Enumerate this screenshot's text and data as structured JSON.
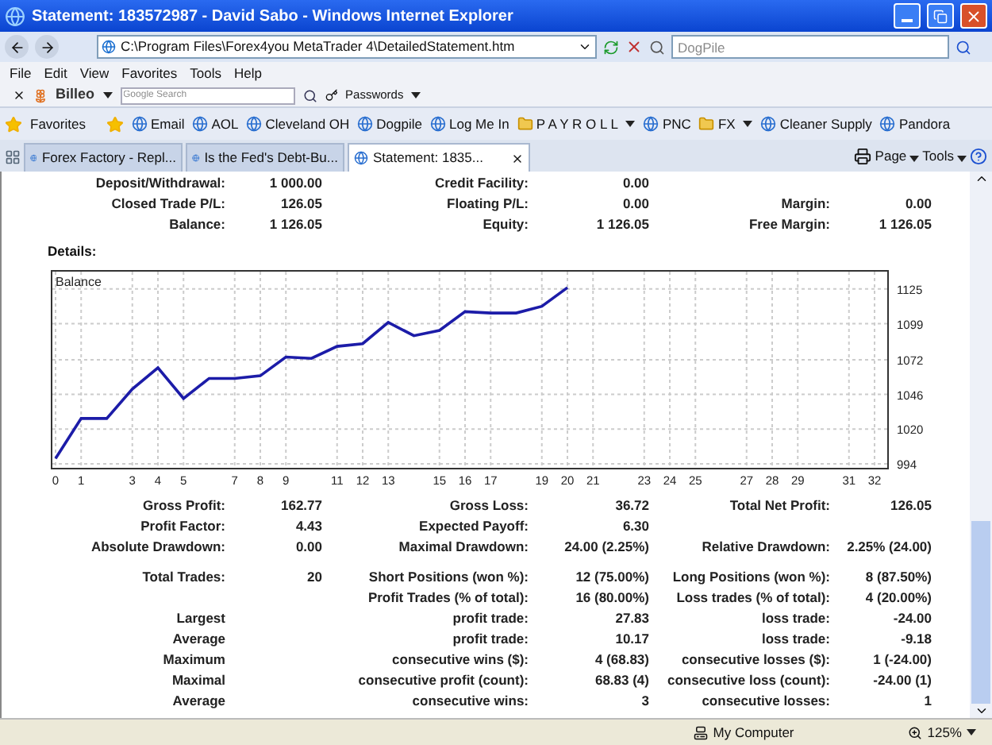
{
  "window": {
    "title": "Statement: 183572987 - David Sabo - Windows Internet Explorer"
  },
  "address_bar": {
    "url": "C:\\Program Files\\Forex4you MetaTrader 4\\DetailedStatement.htm"
  },
  "search": {
    "placeholder": "DogPile"
  },
  "menu": [
    "File",
    "Edit",
    "View",
    "Favorites",
    "Tools",
    "Help"
  ],
  "links_toolbar": {
    "brand": "Billeo",
    "search_placeholder": "Google Search",
    "passwords": "Passwords"
  },
  "favorites_bar": {
    "label": "Favorites",
    "items": [
      {
        "label": "Email",
        "kind": "link"
      },
      {
        "label": "AOL",
        "kind": "link"
      },
      {
        "label": "Cleveland OH",
        "kind": "link"
      },
      {
        "label": "Dogpile",
        "kind": "link"
      },
      {
        "label": "Log Me In",
        "kind": "link"
      },
      {
        "label": "P A Y R O L L",
        "kind": "folder"
      },
      {
        "label": "PNC",
        "kind": "link"
      },
      {
        "label": "FX",
        "kind": "folder"
      },
      {
        "label": "Cleaner Supply",
        "kind": "link"
      },
      {
        "label": "Pandora",
        "kind": "link"
      }
    ]
  },
  "tabs": [
    {
      "label": "Forex Factory - Repl...",
      "selected": false
    },
    {
      "label": "Is the Fed's Debt-Bu...",
      "selected": false
    },
    {
      "label": "Statement: 1835...",
      "selected": true
    }
  ],
  "command_bar": [
    "Page",
    "Tools"
  ],
  "summary": [
    {
      "c1": {
        "label": "Deposit/Withdrawal:",
        "value": "1 000.00"
      },
      "c2": {
        "label": "Credit Facility:",
        "value": "0.00"
      }
    },
    {
      "c1": {
        "label": "Closed Trade P/L:",
        "value": "126.05"
      },
      "c2": {
        "label": "Floating P/L:",
        "value": "0.00"
      },
      "c3": {
        "label": "Margin:",
        "value": "0.00"
      }
    },
    {
      "c1": {
        "label": "Balance:",
        "value": "1 126.05"
      },
      "c2": {
        "label": "Equity:",
        "value": "1 126.05"
      },
      "c3": {
        "label": "Free Margin:",
        "value": "1 126.05"
      }
    }
  ],
  "details_heading": "Details:",
  "chart_data": {
    "type": "line",
    "grid": true,
    "x": [
      0,
      1,
      2,
      3,
      4,
      5,
      6,
      7,
      8,
      9,
      10,
      11,
      12,
      13,
      14,
      15,
      16,
      17,
      18,
      19,
      20
    ],
    "series": [
      {
        "name": "Balance",
        "color": "#1c1ca8",
        "values": [
          998,
          1028,
          1028,
          1050,
          1066,
          1043,
          1058,
          1058,
          1060,
          1074,
          1073,
          1082,
          1084,
          1100,
          1090,
          1094,
          1108,
          1107,
          1107,
          1112,
          1126
        ]
      }
    ],
    "xlim": [
      0,
      32
    ],
    "ylim": [
      994,
      1138
    ],
    "xticks": [
      0,
      1,
      3,
      4,
      5,
      7,
      8,
      9,
      11,
      12,
      13,
      15,
      16,
      17,
      19,
      20,
      21,
      23,
      24,
      25,
      27,
      28,
      29,
      31,
      32
    ],
    "yticks": [
      994,
      1020,
      1046,
      1072,
      1099,
      1125
    ]
  },
  "stats": [
    [
      {
        "c1": {
          "label": "Gross Profit:",
          "value": "162.77"
        },
        "c2": {
          "label": "Gross Loss:",
          "value": "36.72"
        },
        "c3": {
          "label": "Total Net Profit:",
          "value": "126.05"
        }
      },
      {
        "c1": {
          "label": "Profit Factor:",
          "value": "4.43"
        },
        "c2": {
          "label": "Expected Payoff:",
          "value": "6.30"
        }
      },
      {
        "c1": {
          "label": "Absolute Drawdown:",
          "value": "0.00"
        },
        "c2": {
          "label": "Maximal Drawdown:",
          "value": "24.00 (2.25%)"
        },
        "c3": {
          "label": "Relative Drawdown:",
          "value": "2.25% (24.00)"
        }
      }
    ],
    [
      {
        "c1": {
          "label": "Total Trades:",
          "value": "20"
        },
        "c2": {
          "label": "Short Positions (won %):",
          "value": "12 (75.00%)"
        },
        "c3": {
          "label": "Long Positions (won %):",
          "value": "8 (87.50%)"
        }
      },
      {
        "c2": {
          "label": "Profit Trades (% of total):",
          "value": "16 (80.00%)"
        },
        "c3": {
          "label": "Loss trades (% of total):",
          "value": "4 (20.00%)"
        }
      },
      {
        "c1": {
          "label": "Largest"
        },
        "c2": {
          "label": "profit trade:",
          "value": "27.83"
        },
        "c3": {
          "label": "loss trade:",
          "value": "-24.00"
        }
      },
      {
        "c1": {
          "label": "Average"
        },
        "c2": {
          "label": "profit trade:",
          "value": "10.17"
        },
        "c3": {
          "label": "loss trade:",
          "value": "-9.18"
        }
      },
      {
        "c1": {
          "label": "Maximum"
        },
        "c2": {
          "label": "consecutive wins ($):",
          "value": "4 (68.83)"
        },
        "c3": {
          "label": "consecutive losses ($):",
          "value": "1 (-24.00)"
        }
      },
      {
        "c1": {
          "label": "Maximal"
        },
        "c2": {
          "label": "consecutive profit (count):",
          "value": "68.83 (4)"
        },
        "c3": {
          "label": "consecutive loss (count):",
          "value": "-24.00 (1)"
        }
      },
      {
        "c1": {
          "label": "Average"
        },
        "c2": {
          "label": "consecutive wins:",
          "value": "3"
        },
        "c3": {
          "label": "consecutive losses:",
          "value": "1"
        }
      }
    ]
  ],
  "status_bar": {
    "zone": "My Computer",
    "zoom": "125%"
  }
}
